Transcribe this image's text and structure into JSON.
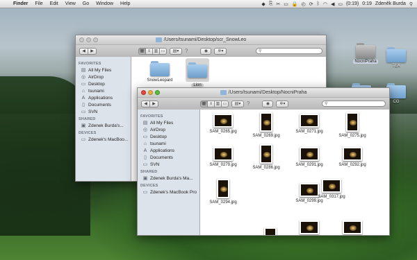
{
  "menubar": {
    "items": [
      "Finder",
      "File",
      "Edit",
      "View",
      "Go",
      "Window",
      "Help"
    ],
    "battery": "(0:19)",
    "clock": "0:19",
    "user": "Zdeněk Burda"
  },
  "desktop_icons": [
    {
      "label": "NocniPraha",
      "selected": true
    },
    {
      "label": "TEX",
      "selected": false
    },
    {
      "label": "CG",
      "selected": false
    }
  ],
  "window_back": {
    "title": "/Users/tsunami/Desktop/scr_SnowLeo",
    "sidebar": {
      "favorites_header": "FAVORITES",
      "favorites": [
        {
          "label": "All My Files",
          "icon": "all-files-icon"
        },
        {
          "label": "AirDrop",
          "icon": "airdrop-icon"
        },
        {
          "label": "Desktop",
          "icon": "desktop-icon"
        },
        {
          "label": "tsunami",
          "icon": "home-icon"
        },
        {
          "label": "Applications",
          "icon": "applications-icon"
        },
        {
          "label": "Documents",
          "icon": "documents-icon"
        },
        {
          "label": "SVN",
          "icon": "folder-icon"
        }
      ],
      "shared_header": "SHARED",
      "shared": [
        {
          "label": "Zdenek Burda's...",
          "icon": "computer-icon"
        }
      ],
      "devices_header": "DEVICES",
      "devices": [
        {
          "label": "Zdenek's MacBoo...",
          "icon": "laptop-icon"
        }
      ]
    },
    "items": [
      {
        "label": "SnowLeopard",
        "selected": false
      },
      {
        "label": "Lion",
        "selected": true
      }
    ]
  },
  "window_front": {
    "title": "/Users/tsunami/Desktop/NocniPraha",
    "sidebar": {
      "favorites_header": "FAVORITES",
      "favorites": [
        {
          "label": "All My Files",
          "icon": "all-files-icon"
        },
        {
          "label": "AirDrop",
          "icon": "airdrop-icon"
        },
        {
          "label": "Desktop",
          "icon": "desktop-icon"
        },
        {
          "label": "tsunami",
          "icon": "home-icon"
        },
        {
          "label": "Applications",
          "icon": "applications-icon"
        },
        {
          "label": "Documents",
          "icon": "documents-icon"
        },
        {
          "label": "SVN",
          "icon": "folder-icon"
        }
      ],
      "shared_header": "SHARED",
      "shared": [
        {
          "label": "Zdenek Burda's Ma...",
          "icon": "computer-icon"
        }
      ],
      "devices_header": "DEVICES",
      "devices": [
        {
          "label": "Zdenek's MacBook Pro",
          "icon": "laptop-icon"
        }
      ]
    },
    "files": [
      {
        "name": "SAM_0265.jpg",
        "orientation": "landscape"
      },
      {
        "name": "SAM_0269.jpg",
        "orientation": "portrait"
      },
      {
        "name": "SAM_0271.jpg",
        "orientation": "landscape"
      },
      {
        "name": "SAM_0275.jpg",
        "orientation": "portrait"
      },
      {
        "name": "SAM_0279.jpg",
        "orientation": "landscape"
      },
      {
        "name": "SAM_0286.jpg",
        "orientation": "portrait"
      },
      {
        "name": "SAM_0291.jpg",
        "orientation": "landscape"
      },
      {
        "name": "SAM_0292.jpg",
        "orientation": "landscape"
      },
      {
        "name": "SAM_0294.jpg",
        "orientation": "portrait"
      },
      {
        "name": "SAM_0299.jpg",
        "orientation": "landscape"
      },
      {
        "name": "SAM_0317.jpg",
        "orientation": "landscape"
      },
      {
        "name": "",
        "orientation": "portrait"
      },
      {
        "name": "",
        "orientation": "landscape"
      },
      {
        "name": "",
        "orientation": "landscape"
      }
    ]
  },
  "colors": {
    "sidebar_bg": "#dde3ea",
    "selection": "#ccd3e0",
    "folder_blue": "#8fb6d8"
  }
}
